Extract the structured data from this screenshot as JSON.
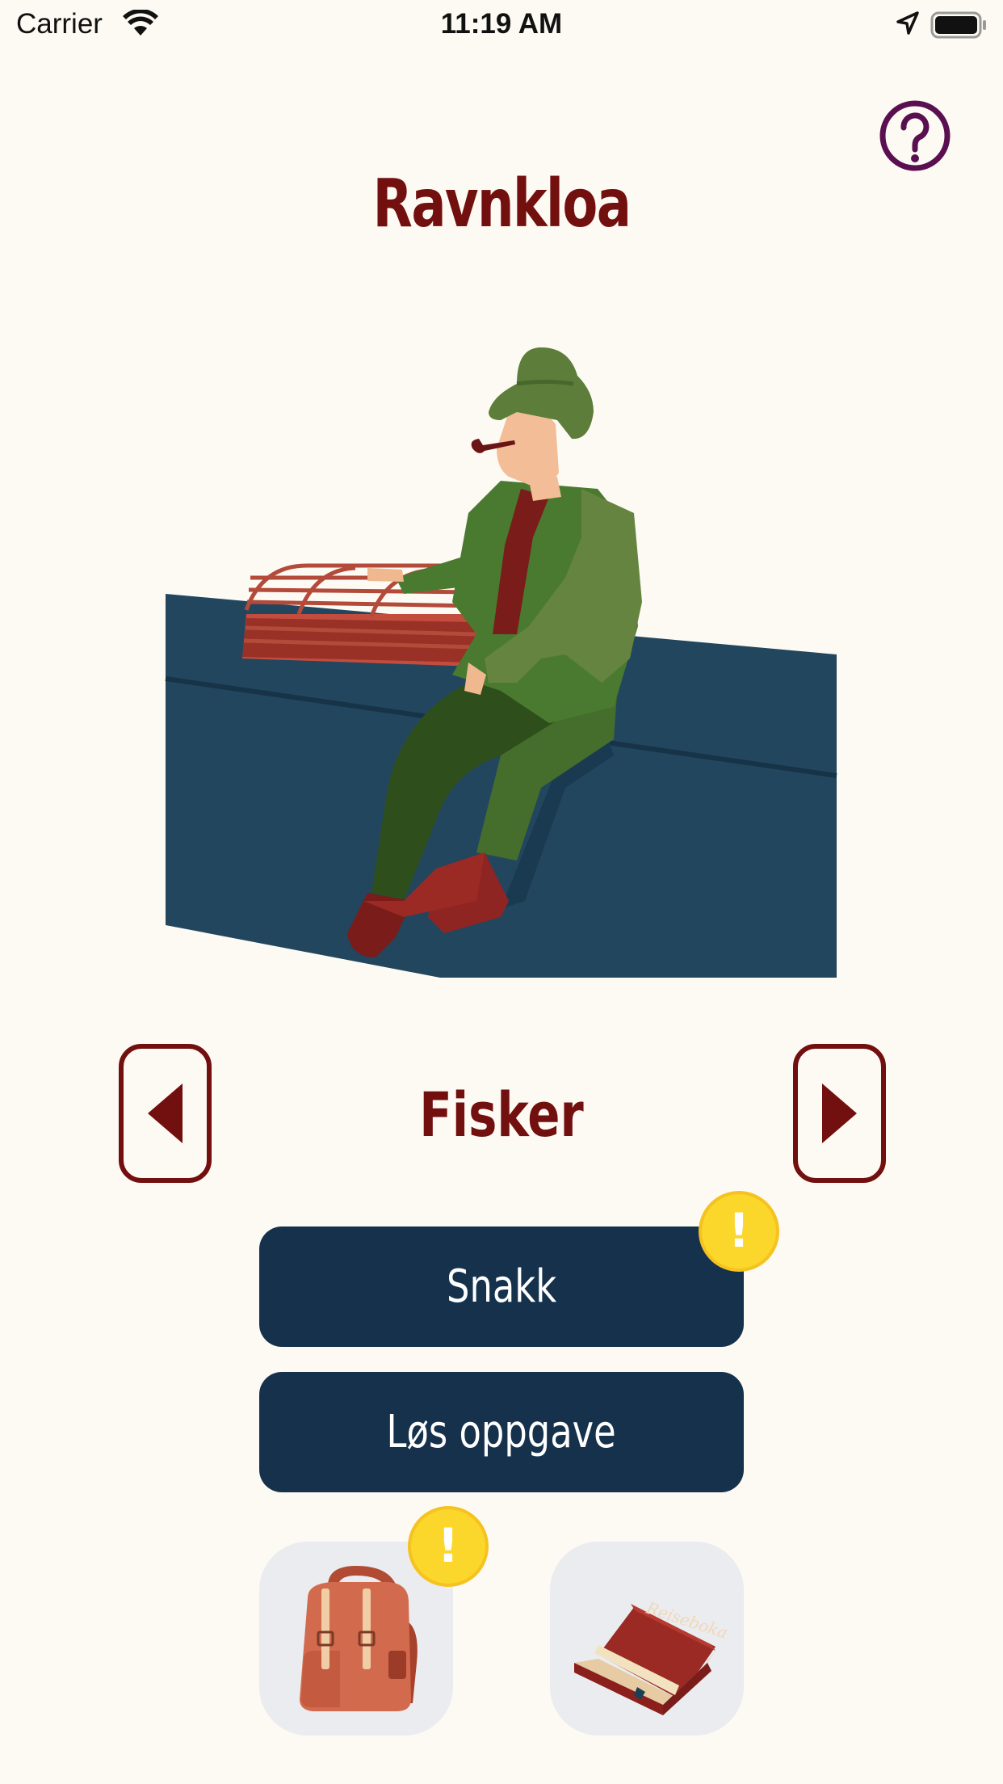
{
  "status_bar": {
    "carrier": "Carrier",
    "time": "11:19 AM",
    "icons": [
      "wifi-icon",
      "location-arrow-icon",
      "battery-icon"
    ]
  },
  "header": {
    "title": "Ravnkloa",
    "help_icon": "question-circle-icon"
  },
  "character": {
    "role": "Fisker",
    "illustration": "fisherman-on-quay-with-lobster-trap",
    "prev_icon": "triangle-left-icon",
    "next_icon": "triangle-right-icon"
  },
  "actions": {
    "talk_label": "Snakk",
    "task_label": "Løs oppgave",
    "talk_badge": "!",
    "backpack_badge": "!"
  },
  "tiles": {
    "backpack_icon": "backpack-icon",
    "book_icon": "book-icon",
    "book_title": "Reiseboka"
  },
  "colors": {
    "background": "#fdfaf3",
    "accent": "#720f0f",
    "button": "#15314c",
    "badge": "#fbd62b",
    "tile": "#eaecef",
    "help": "#5a1050"
  }
}
